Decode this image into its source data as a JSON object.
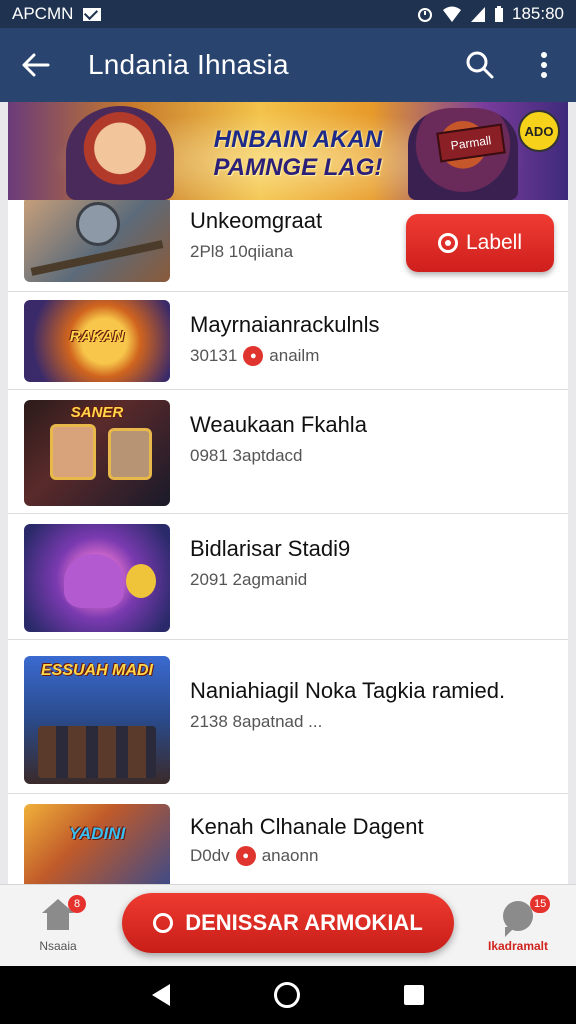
{
  "status_bar": {
    "carrier": "APCMN",
    "time": "185:80"
  },
  "app_bar": {
    "title": "Lndania Ihnasia"
  },
  "banner": {
    "line1": "HNBAIN AKAN",
    "line2": "PAMNGE LAG!",
    "badge": "ADO",
    "sign": "Parmall"
  },
  "list": [
    {
      "title": "Unkeomgraat",
      "meta": "2Pl8 10qiiana",
      "meta_icon": false,
      "thumb_text": "",
      "action_label": "Labell"
    },
    {
      "title": "Mayrnaianrackulnls",
      "meta": "30131",
      "meta2": "anailm",
      "meta_icon": true,
      "thumb_text": "RAKAN"
    },
    {
      "title": "Weaukaan Fkahla",
      "meta": "0981 3aptdacd",
      "meta_icon": false,
      "thumb_text": "SANER"
    },
    {
      "title": "Bidlarisar Stadi9",
      "meta": "2091 2agmanid",
      "meta_icon": false,
      "thumb_text": ""
    },
    {
      "title": "Naniahiagil Noka Tagkia ramied.",
      "meta": "2138 8apatnad ...",
      "meta_icon": false,
      "thumb_text": "ESSUAH MADI"
    },
    {
      "title": "Kenah Clhanale Dagent",
      "meta": "D0dv",
      "meta2": "anaonn",
      "meta_icon": true,
      "thumb_text": "YADINI"
    }
  ],
  "bottom_bar": {
    "home_label": "Nsaaia",
    "home_badge": "8",
    "cta_label": "DENISSAR ARMOKIAL",
    "chat_label": "Ikadramalt",
    "chat_badge": "15"
  }
}
